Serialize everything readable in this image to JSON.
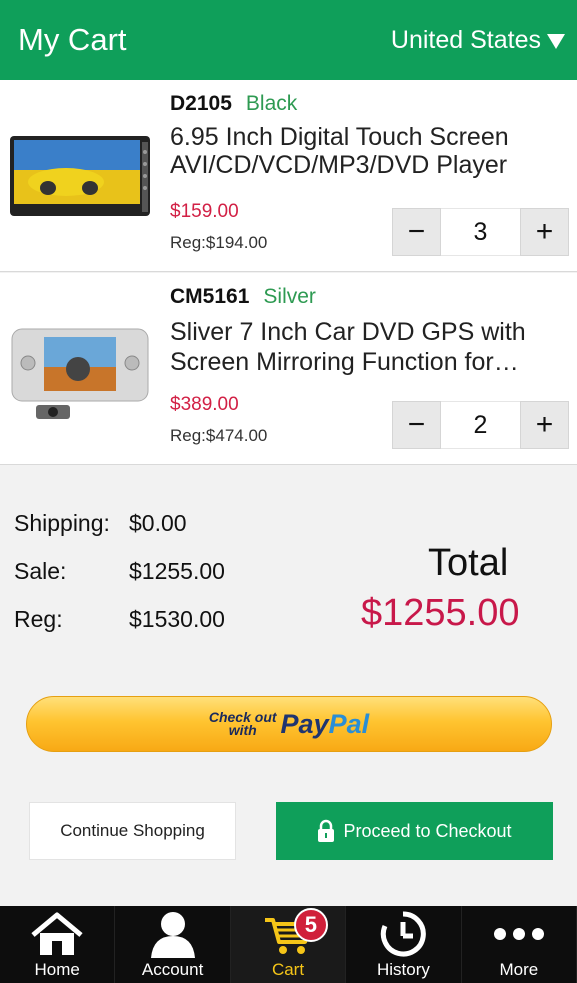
{
  "header": {
    "title": "My Cart",
    "country": "United States"
  },
  "items": [
    {
      "sku": "D2105",
      "color": "Black",
      "name": "6.95 Inch Digital Touch Screen AVI/CD/VCD/MP3/DVD Player",
      "price": "$159.00",
      "reg": "Reg:$194.00",
      "qty": "3"
    },
    {
      "sku": "CM5161",
      "color": "Silver",
      "name": "Sliver 7 Inch Car DVD GPS with Screen Mirroring Function for…",
      "price": "$389.00",
      "reg": "Reg:$474.00",
      "qty": "2"
    }
  ],
  "qty_controls": {
    "minus": "−",
    "plus": "+"
  },
  "summary": {
    "shipping_label": "Shipping:",
    "shipping_value": "$0.00",
    "sale_label": "Sale:",
    "sale_value": "$1255.00",
    "reg_label": "Reg:",
    "reg_value": "$1530.00",
    "total_label": "Total",
    "total_value": "$1255.00"
  },
  "paypal": {
    "line1": "Check out",
    "line2": "with",
    "logo_pay": "Pay",
    "logo_pal": "Pal"
  },
  "buttons": {
    "continue": "Continue Shopping",
    "checkout": "Proceed to Checkout"
  },
  "tabbar": {
    "tabs": [
      {
        "label": "Home",
        "icon": "home-icon"
      },
      {
        "label": "Account",
        "icon": "account-icon"
      },
      {
        "label": "Cart",
        "icon": "cart-icon"
      },
      {
        "label": "History",
        "icon": "history-icon"
      },
      {
        "label": "More",
        "icon": "more-icon"
      }
    ],
    "cart_badge": "5"
  },
  "colors": {
    "brand_green": "#0f9f5a",
    "price_red": "#d22045",
    "total_red": "#c8184a",
    "active_tab": "#f5c518"
  }
}
